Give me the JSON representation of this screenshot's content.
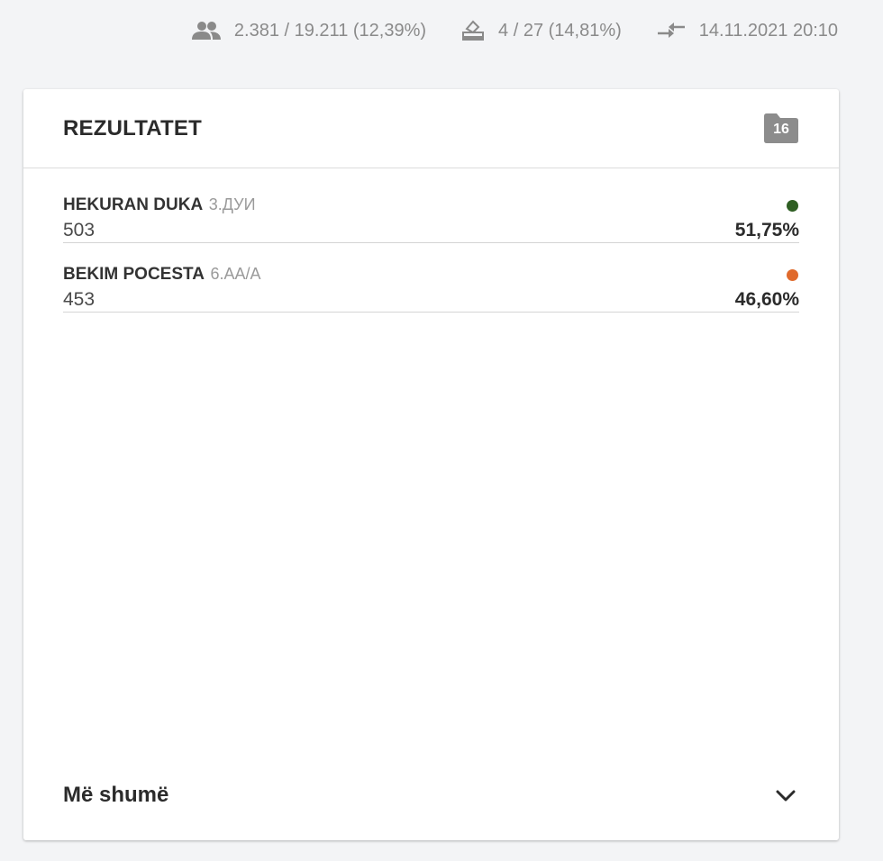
{
  "stats": {
    "voters": {
      "icon": "people-icon",
      "text": "2.381 / 19.211 (12,39%)"
    },
    "stations": {
      "icon": "ballot-box-icon",
      "text": "4 / 27 (14,81%)"
    },
    "updated": {
      "icon": "swap-arrows-icon",
      "text": "14.11.2021 20:10"
    }
  },
  "card": {
    "title": "REZULTATET",
    "badge_icon": "folder-icon",
    "badge_count": "16",
    "candidates": [
      {
        "name": "HEKURAN DUKA",
        "party": "3.ДУИ",
        "votes": "503",
        "percent": "51,75%",
        "color": "#2f5f23"
      },
      {
        "name": "BEKIM POCESTA",
        "party": "6.АА/А",
        "votes": "453",
        "percent": "46,60%",
        "color": "#e06a2c"
      }
    ],
    "more_label": "Më shumë",
    "more_icon": "chevron-down-icon"
  },
  "colors": {
    "background": "#f3f4f6",
    "muted_text": "#8a8a8a",
    "badge": "#8c8c8c"
  }
}
